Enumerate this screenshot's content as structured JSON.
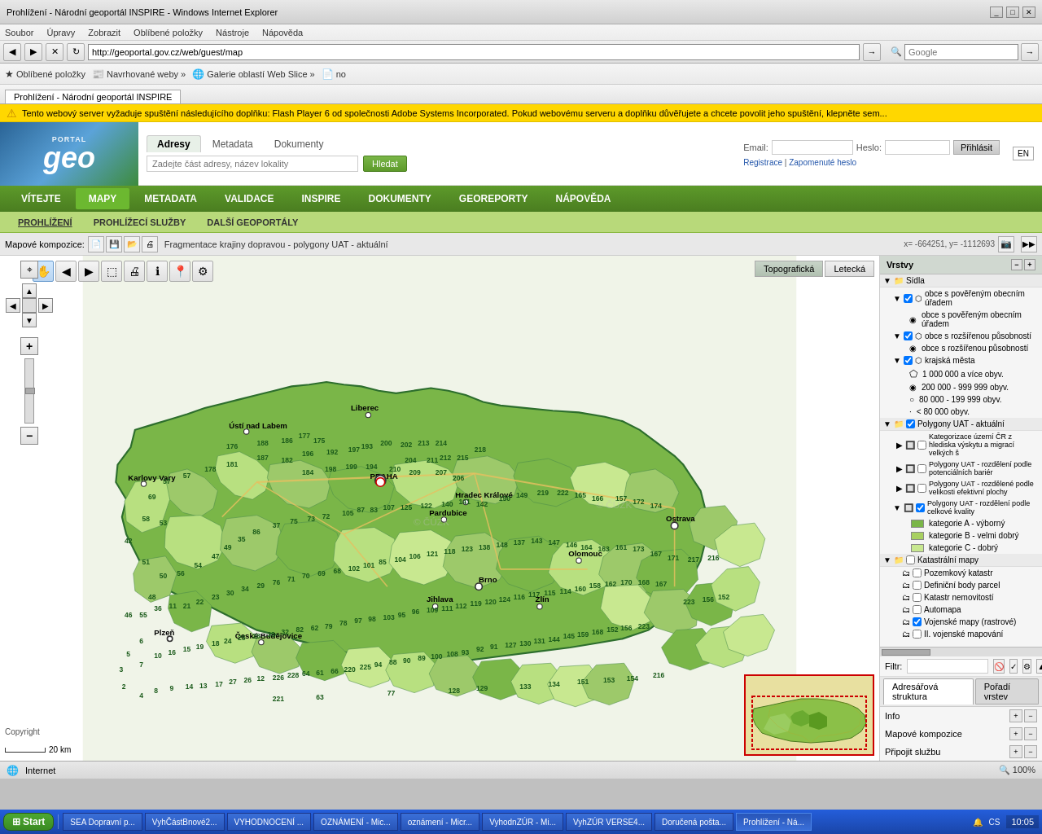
{
  "browser": {
    "title": "Prohlížení - Národní geoportál INSPIRE - Windows Internet Explorer",
    "url": "http://geoportal.gov.cz/web/guest/map",
    "search_placeholder": "Google",
    "tab_label": "Prohlížení - Národní geoportál INSPIRE"
  },
  "favorites": {
    "oblibene": "Oblíbené položky",
    "navrhowane": "Navrhované weby »",
    "galerie": "Galerie oblastí Web Slice »",
    "no": "no"
  },
  "menu": {
    "soubor": "Soubor",
    "upravy": "Úpravy",
    "zobrazit": "Zobrazit",
    "oblibene_polozky": "Oblíbené položky",
    "nastroje": "Nástroje",
    "napoveda": "Nápověda"
  },
  "portal": {
    "logo_portal": "PORTAL",
    "logo_geo": "geo",
    "tabs": [
      {
        "label": "Adresy",
        "active": true
      },
      {
        "label": "Metadata"
      },
      {
        "label": "Dokumenty"
      }
    ],
    "search_placeholder": "Zadejte část adresy, název lokality",
    "search_button": "Hledat",
    "email_label": "Email:",
    "heslo_label": "Heslo:",
    "login_button": "Přihlásit",
    "register_link": "Registrace",
    "forgot_link": "Zapomenuté heslo",
    "lang": "EN"
  },
  "main_nav": [
    {
      "label": "VÍTEJTE"
    },
    {
      "label": "MAPY",
      "active": true
    },
    {
      "label": "METADATA"
    },
    {
      "label": "VALIDACE"
    },
    {
      "label": "INSPIRE"
    },
    {
      "label": "DOKUMENTY"
    },
    {
      "label": "GEOREPORTY"
    },
    {
      "label": "NÁPOVĚDA"
    }
  ],
  "sub_nav": [
    {
      "label": "PROHLÍŽENÍ",
      "active": true
    },
    {
      "label": "PROHLÍŽECÍ SLUŽBY"
    },
    {
      "label": "DALŠÍ GEOPORTÁLY"
    }
  ],
  "map_toolbar": {
    "map_compositions_label": "Mapové kompozice:",
    "title": "Fragmentace krajiny dopravou - polygony UAT - aktuální",
    "coords": "x= -664251, y= -1112693",
    "basemap_topo": "Topografická",
    "basemap_letecka": "Letecká"
  },
  "layers": {
    "header": "Vrstvy",
    "items": [
      {
        "label": "Sídla",
        "type": "group",
        "expanded": true
      },
      {
        "label": "obce s pověřeným obecním úřadem",
        "type": "subgroup",
        "checked": true
      },
      {
        "label": "obce s pověřeným obecním úřadem",
        "type": "legend-text"
      },
      {
        "label": "obce s rozšířenou působností",
        "type": "subgroup",
        "checked": true
      },
      {
        "label": "obce s rozšířenou působností",
        "type": "legend-text"
      },
      {
        "label": "krajská města",
        "type": "subgroup",
        "checked": true
      },
      {
        "label": "1 000 000 a více obyv.",
        "type": "legend"
      },
      {
        "label": "200 000 - 999 999 obyv.",
        "type": "legend"
      },
      {
        "label": "80 000 - 199 999 obyv.",
        "type": "legend"
      },
      {
        "label": "< 80 000 obyv.",
        "type": "legend"
      },
      {
        "label": "Polygony UAT - aktuální",
        "type": "group",
        "expanded": true
      },
      {
        "label": "Kategorizace území ČR z hlediska výskytu a migrací velkých š",
        "type": "item"
      },
      {
        "label": "Polygony UAT - rozdělení podle potenciálních bariér",
        "type": "item"
      },
      {
        "label": "Polygony UAT - rozdělené podle velikosti efektivní plochy",
        "type": "item"
      },
      {
        "label": "Polygony UAT - rozdělení podle celkové kvality",
        "type": "subgroup",
        "expanded": true
      },
      {
        "label": "kategorie A - výborný",
        "type": "legend-color",
        "color": "#7ab648"
      },
      {
        "label": "kategorie B - velmi dobrý",
        "type": "legend-color",
        "color": "#a8d060"
      },
      {
        "label": "kategorie C - dobrý",
        "type": "legend-color",
        "color": "#c8e890"
      },
      {
        "label": "Katastrální mapy",
        "type": "group",
        "expanded": true
      },
      {
        "label": "Pozemkový katastr",
        "type": "item"
      },
      {
        "label": "Definiční body parcel",
        "type": "item"
      },
      {
        "label": "Katastr nemovitostí",
        "type": "item"
      },
      {
        "label": "Automapa",
        "type": "item"
      },
      {
        "label": "Vojenské mapy (rastrové)",
        "type": "item",
        "checked": true
      },
      {
        "label": "II. vojenské mapování",
        "type": "item"
      }
    ]
  },
  "bottom_panels": {
    "filter_label": "Filtr:",
    "tab1": "Adresářová struktura",
    "tab2": "Pořadí vrstev",
    "section_info": "Info",
    "section_compositions": "Mapové kompozice",
    "section_connect": "Připojit službu"
  },
  "map_labels": {
    "cities": [
      "Praha",
      "Brno",
      "Ostrava",
      "Plzeň",
      "Liberec",
      "Olomouc",
      "Zlín",
      "Hradec Králové",
      "Pardubice",
      "České Budějovice",
      "Ústí nad Labem",
      "Jihlava",
      "Karlovy Vary"
    ],
    "watermarks": [
      "© ČÚZK",
      "© ČÚZK"
    ],
    "copyright": "Copyright",
    "scale": "20 km"
  },
  "status_bar": {
    "zone": "Internet",
    "zoom": "100%"
  },
  "taskbar": {
    "start": "Start",
    "items": [
      "SEA Dopravní p...",
      "VyhČástBnové2...",
      "VYHODNOCENÍ ...",
      "OZNÁMENÍ - Mic...",
      "oznámeni - Micr...",
      "VyhodnZÚR - Mi...",
      "VyhZÚR VERSE4...",
      "Doručená pošta...",
      "Prohlížení - Ná..."
    ],
    "clock": "10:05"
  }
}
